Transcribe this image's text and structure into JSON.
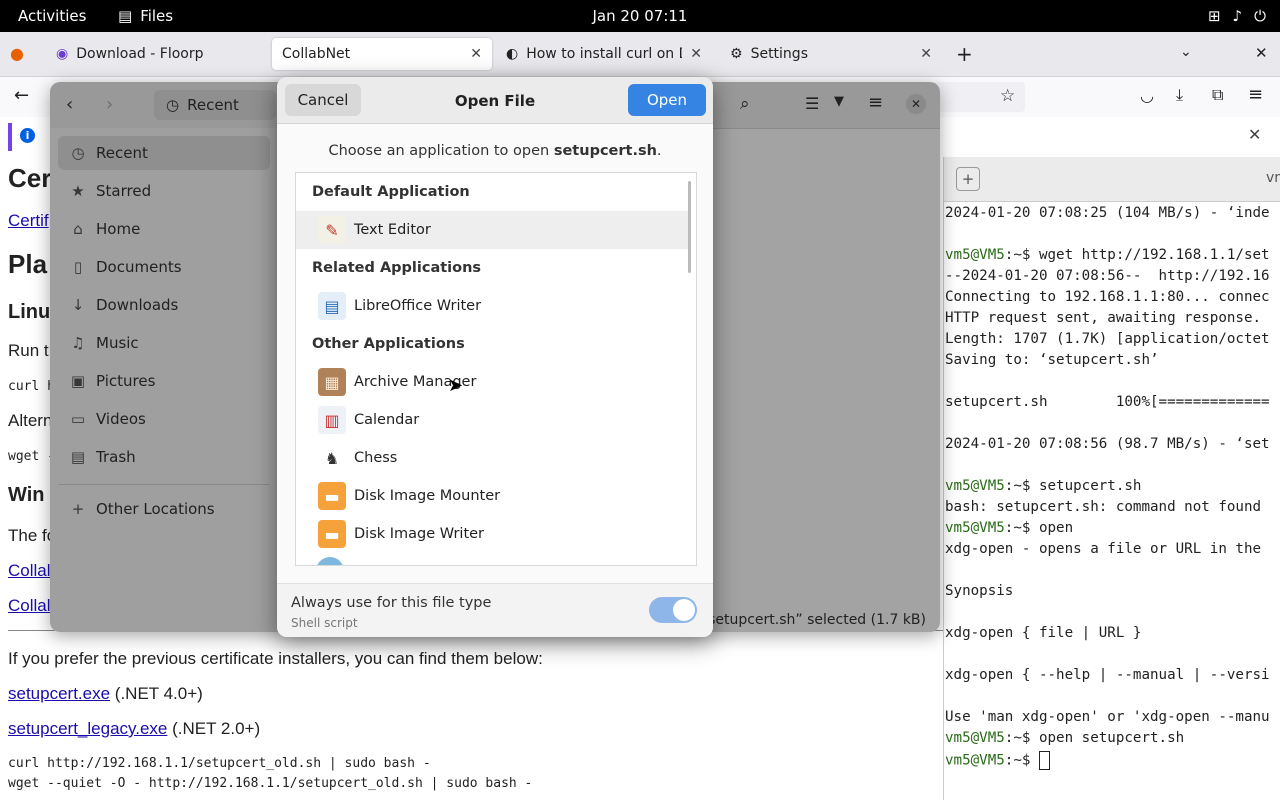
{
  "topbar": {
    "activities": "Activities",
    "app_name": "Files",
    "clock": "Jan 20  07:11"
  },
  "browser": {
    "tabs": [
      {
        "label": "Download - Floorp"
      },
      {
        "label": "CollabNet"
      },
      {
        "label": "How to install curl on Deb"
      },
      {
        "label": "Settings"
      }
    ],
    "new_tab": "+",
    "info_badge": "i"
  },
  "page": {
    "h1": "Cer",
    "link1": "Certif",
    "h_platform": "Pla",
    "h_linux": "Linu",
    "run_text": "Run t",
    "curl_frag": "curl h",
    "alt_text": "Altern",
    "wget_frag": "wget -",
    "h_win": "Win",
    "the_text": "The fo",
    "collab1": "Collal",
    "collab2": "Collal",
    "prefer": "If you prefer the previous certificate installers, you can find them below:",
    "link_exe": "setupcert.exe",
    "exe_note": " (.NET 4.0+)",
    "link_legacy": "setupcert_legacy.exe",
    "legacy_note": " (.NET 2.0+)",
    "code1": "curl http://192.168.1.1/setupcert_old.sh | sudo bash -",
    "code2": "wget --quiet -O - http://192.168.1.1/setupcert_old.sh | sudo bash -"
  },
  "files": {
    "location": "Recent",
    "sidebar": [
      {
        "label": "Recent",
        "icon": "clock-icon",
        "glyph": "◷"
      },
      {
        "label": "Starred",
        "icon": "star-icon",
        "glyph": "★"
      },
      {
        "label": "Home",
        "icon": "home-icon",
        "glyph": "⌂"
      },
      {
        "label": "Documents",
        "icon": "document-icon",
        "glyph": "▯"
      },
      {
        "label": "Downloads",
        "icon": "download-icon",
        "glyph": "↓"
      },
      {
        "label": "Music",
        "icon": "music-icon",
        "glyph": "♫"
      },
      {
        "label": "Pictures",
        "icon": "picture-icon",
        "glyph": "▣"
      },
      {
        "label": "Videos",
        "icon": "video-icon",
        "glyph": "▭"
      },
      {
        "label": "Trash",
        "icon": "trash-icon",
        "glyph": "▤"
      }
    ],
    "other_locations": "Other Locations",
    "status": "“setupcert.sh” selected  (1.7 kB)"
  },
  "terminal": {
    "title_frag": "vn",
    "lines": [
      "2024-01-20 07:08:25 (104 MB/s) - ‘inde",
      "",
      "@@vm5@VM5:~$ wget http://192.168.1.1/set",
      "--2024-01-20 07:08:56--  http://192.16",
      "Connecting to 192.168.1.1:80... connec",
      "HTTP request sent, awaiting response.",
      "Length: 1707 (1.7K) [application/octet",
      "Saving to: ‘setupcert.sh’",
      "",
      "setupcert.sh        100%[=============",
      "",
      "2024-01-20 07:08:56 (98.7 MB/s) - ‘set",
      "",
      "@@vm5@VM5:~$ setupcert.sh",
      "bash: setupcert.sh: command not found",
      "@@vm5@VM5:~$ open",
      "xdg-open - opens a file or URL in the",
      "",
      "Synopsis",
      "",
      "xdg-open { file | URL }",
      "",
      "xdg-open { --help | --manual | --versi",
      "",
      "Use 'man xdg-open' or 'xdg-open --manu",
      "@@vm5@VM5:~$ open setupcert.sh",
      "@@vm5@VM5:~$ "
    ]
  },
  "dialog": {
    "title": "Open File",
    "cancel": "Cancel",
    "open": "Open",
    "prompt_prefix": "Choose an application to open ",
    "prompt_file": "setupcert.sh",
    "prompt_suffix": ".",
    "sections": {
      "default": "Default Application",
      "related": "Related Applications",
      "other": "Other Applications"
    },
    "default_apps": [
      {
        "name": "Text Editor",
        "icon": "text-editor-icon",
        "glyph": "✎",
        "bg": "#f3f1e6",
        "fg": "#c0392b"
      }
    ],
    "related_apps": [
      {
        "name": "LibreOffice Writer",
        "icon": "libreoffice-writer-icon",
        "glyph": "▤",
        "bg": "#e3eef9",
        "fg": "#2a6db3"
      }
    ],
    "other_apps": [
      {
        "name": "Archive Manager",
        "icon": "archive-manager-icon",
        "glyph": "▦",
        "bg": "#b08259",
        "fg": "#f5e6d3"
      },
      {
        "name": "Calendar",
        "icon": "calendar-icon",
        "glyph": "▥",
        "bg": "#eef2f7",
        "fg": "#c63030"
      },
      {
        "name": "Chess",
        "icon": "chess-icon",
        "glyph": "♞",
        "bg": "#ffffff",
        "fg": "#333333"
      },
      {
        "name": "Disk Image Mounter",
        "icon": "disk-image-mounter-icon",
        "glyph": "▬",
        "bg": "#f5a23a",
        "fg": "#ffffff"
      },
      {
        "name": "Disk Image Writer",
        "icon": "disk-image-writer-icon",
        "glyph": "▬",
        "bg": "#f5a23a",
        "fg": "#ffffff"
      }
    ],
    "always_use": "Always use for this file type",
    "file_type": "Shell script",
    "always_use_on": true
  }
}
